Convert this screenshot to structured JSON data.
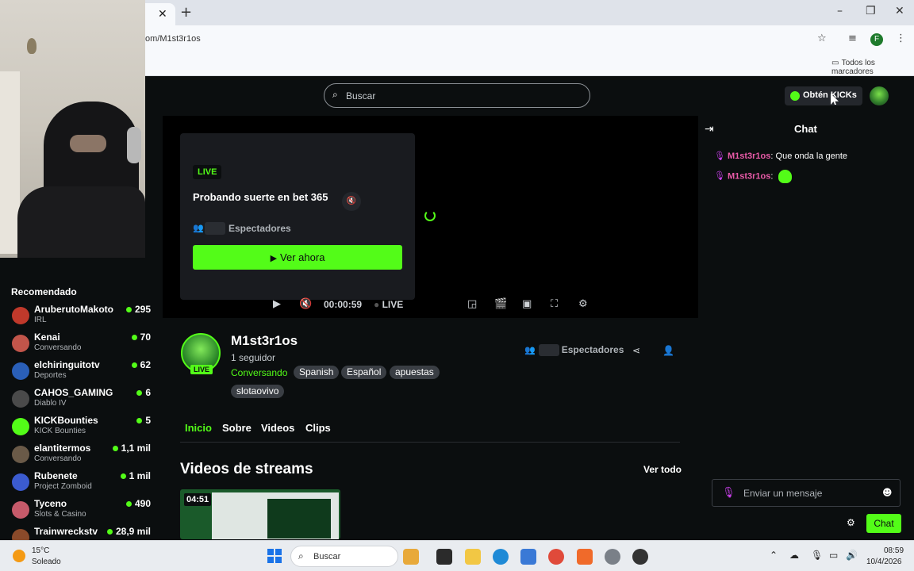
{
  "browser": {
    "url": "om/M1st3r1os",
    "bookmarks_label": "Todos los marcadores",
    "profile_initial": "F"
  },
  "app": {
    "search_placeholder": "Buscar",
    "kicks_label": "Obtén KICKs",
    "brand_color": "#53fc18"
  },
  "sidebar": {
    "heading": "Recomendado",
    "items": [
      {
        "name": "AruberutoMakoto",
        "category": "IRL",
        "viewers": "295",
        "avatar_color": "#c0392b"
      },
      {
        "name": "Kenai",
        "category": "Conversando",
        "viewers": "70",
        "avatar_color": "#c2554a"
      },
      {
        "name": "elchiringuitotv",
        "category": "Deportes",
        "viewers": "62",
        "avatar_color": "#2a5fb8"
      },
      {
        "name": "CAHOS_GAMING",
        "category": "Diablo IV",
        "viewers": "6",
        "avatar_color": "#4a4a4a"
      },
      {
        "name": "KICKBounties",
        "category": "KICK Bounties",
        "viewers": "5",
        "avatar_color": "#53fc18"
      },
      {
        "name": "elantitermos",
        "category": "Conversando",
        "viewers": "1,1 mil",
        "avatar_color": "#6a5a48"
      },
      {
        "name": "Rubenete",
        "category": "Project Zomboid",
        "viewers": "1 mil",
        "avatar_color": "#3b5bcf"
      },
      {
        "name": "Tyceno",
        "category": "Slots & Casino",
        "viewers": "490",
        "avatar_color": "#c65a6a"
      },
      {
        "name": "Trainwreckstv",
        "category": "",
        "viewers": "28,9 mil",
        "avatar_color": "#8a4a2a"
      }
    ]
  },
  "player": {
    "live_badge": "LIVE",
    "stream_title": "Probando suerte en bet 365",
    "viewers_label": "Espectadores",
    "watch_now": "Ver ahora",
    "time": "00:00:59",
    "live_label": "LIVE"
  },
  "channel": {
    "name": "M1st3r1os",
    "followers": "1 seguidor",
    "category": "Conversando",
    "live_badge": "LIVE",
    "tags": [
      "Spanish",
      "Español",
      "apuestas",
      "slotaovivo"
    ],
    "viewers_label": "Espectadores"
  },
  "tabs": [
    "Inicio",
    "Sobre",
    "Videos",
    "Clips"
  ],
  "videos": {
    "heading": "Videos de streams",
    "view_all": "Ver todo",
    "thumb_duration": "04:51"
  },
  "chat": {
    "title": "Chat",
    "messages": [
      {
        "user": "M1st3r1os",
        "text": "Que onda la gente",
        "emote": false
      },
      {
        "user": "M1st3r1os",
        "text": "",
        "emote": true
      }
    ],
    "input_placeholder": "Enviar un mensaje",
    "send_label": "Chat"
  },
  "taskbar": {
    "temperature": "15°C",
    "condition": "Soleado",
    "search_label": "Buscar",
    "time": "08:59",
    "date": "10/4/2026"
  }
}
